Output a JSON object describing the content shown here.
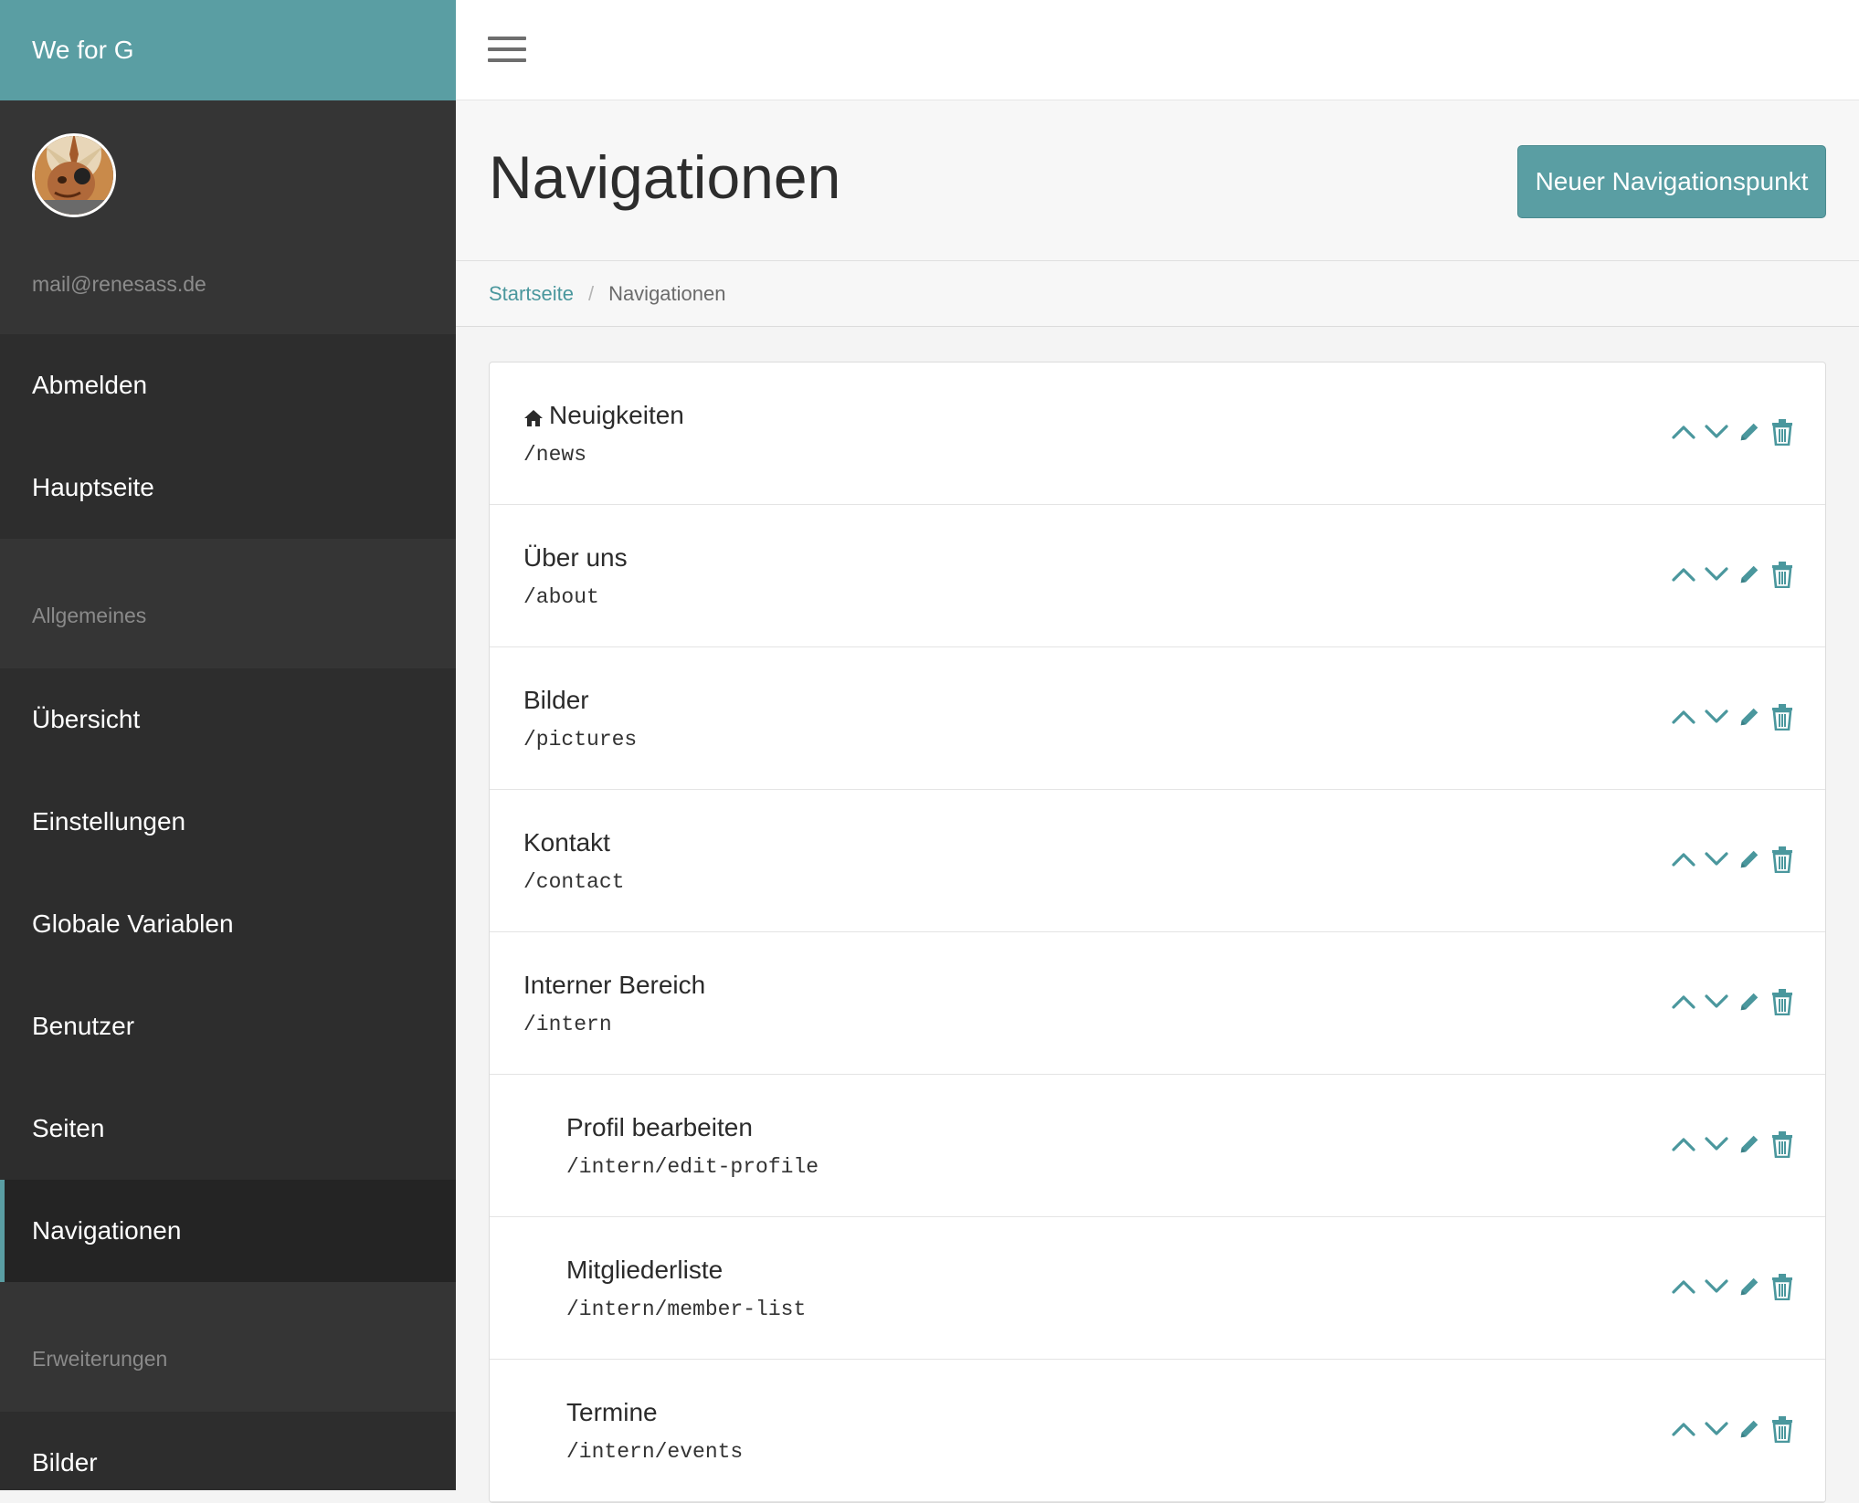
{
  "app": {
    "brand": "We for G"
  },
  "profile": {
    "email": "mail@renesass.de"
  },
  "sidebar": {
    "top_items": [
      {
        "label": "Abmelden"
      },
      {
        "label": "Hauptseite"
      }
    ],
    "section_general": "Allgemeines",
    "general_items": [
      {
        "label": "Übersicht"
      },
      {
        "label": "Einstellungen"
      },
      {
        "label": "Globale Variablen"
      },
      {
        "label": "Benutzer"
      },
      {
        "label": "Seiten"
      },
      {
        "label": "Navigationen",
        "active": true
      }
    ],
    "section_extensions": "Erweiterungen",
    "extension_items": [
      {
        "label": "Bilder"
      }
    ]
  },
  "header": {
    "title": "Navigationen",
    "new_button": "Neuer Navigationspunkt"
  },
  "breadcrumb": {
    "home": "Startseite",
    "separator": "/",
    "current": "Navigationen"
  },
  "navigation_items": [
    {
      "title": "Neuigkeiten",
      "path": "/news",
      "home": true,
      "level": 0
    },
    {
      "title": "Über uns",
      "path": "/about",
      "level": 0
    },
    {
      "title": "Bilder",
      "path": "/pictures",
      "level": 0
    },
    {
      "title": "Kontakt",
      "path": "/contact",
      "level": 0
    },
    {
      "title": "Interner Bereich",
      "path": "/intern",
      "level": 0
    },
    {
      "title": "Profil bearbeiten",
      "path": "/intern/edit-profile",
      "level": 1
    },
    {
      "title": "Mitgliederliste",
      "path": "/intern/member-list",
      "level": 1
    },
    {
      "title": "Termine",
      "path": "/intern/events",
      "level": 1
    }
  ],
  "icons": {
    "home": "home-icon",
    "up": "chevron-up-icon",
    "down": "chevron-down-icon",
    "edit": "pencil-icon",
    "delete": "trash-icon",
    "menu": "hamburger-icon"
  },
  "colors": {
    "accent": "#5a9ea3",
    "sidebar": "#2d2d2d",
    "sidebar_alt": "#353535",
    "action_icon": "#4a979d"
  }
}
